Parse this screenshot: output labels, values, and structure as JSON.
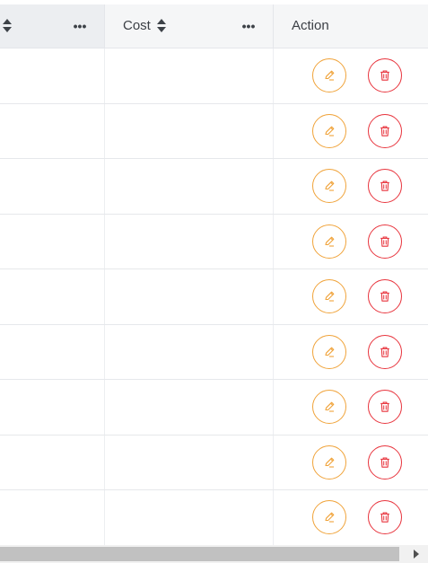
{
  "table": {
    "columns": [
      {
        "label": ""
      },
      {
        "label": "Cost"
      },
      {
        "label": "Action"
      }
    ],
    "row_count": 9,
    "rows": [
      {
        "col0": "",
        "cost": ""
      },
      {
        "col0": "",
        "cost": ""
      },
      {
        "col0": "",
        "cost": ""
      },
      {
        "col0": "",
        "cost": ""
      },
      {
        "col0": "",
        "cost": ""
      },
      {
        "col0": "",
        "cost": ""
      },
      {
        "col0": "",
        "cost": ""
      },
      {
        "col0": "",
        "cost": ""
      },
      {
        "col0": "",
        "cost": ""
      }
    ],
    "actions": {
      "edit_icon": "pencil-icon",
      "delete_icon": "trash-icon",
      "edit_color": "#f0a33a",
      "delete_color": "#e8343d"
    }
  },
  "colors": {
    "header_bg": "#f5f6f7",
    "header_sorted_bg": "#eceef1",
    "border": "#e4e6ea",
    "text": "#3b3f45",
    "scrollbar_thumb": "#c1c1c1"
  }
}
